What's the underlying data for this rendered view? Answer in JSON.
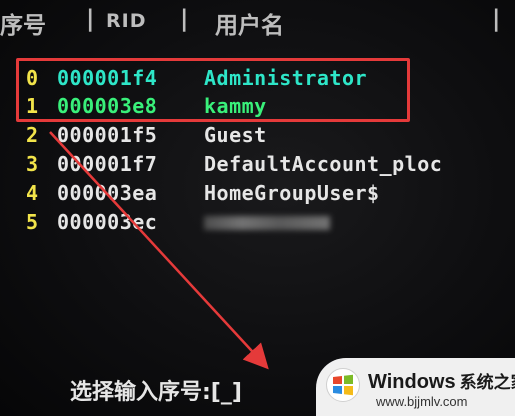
{
  "header": {
    "seq_label": "序号",
    "separator": "|",
    "rid_label": "RID",
    "username_label": "用户名"
  },
  "users": [
    {
      "index": "0",
      "rid": "000001f4",
      "name": "Administrator"
    },
    {
      "index": "1",
      "rid": "000003e8",
      "name": "kammy"
    },
    {
      "index": "2",
      "rid": "000001f5",
      "name": "Guest"
    },
    {
      "index": "3",
      "rid": "000001f7",
      "name": "DefaultAccount_ploc"
    },
    {
      "index": "4",
      "rid": "000003ea",
      "name": "HomeGroupUser$"
    },
    {
      "index": "5",
      "rid": "000003ec",
      "name": ""
    }
  ],
  "prompt": {
    "text": "选择输入序号:[_]"
  },
  "watermark": {
    "brand": "Windows",
    "brand_cn": "系统之家",
    "url": "www.bjjmlv.com"
  },
  "colors": {
    "highlight": "#e53a3a",
    "index": "#f2e44a",
    "row0": "#2ee6c8",
    "row1": "#39f07a"
  }
}
